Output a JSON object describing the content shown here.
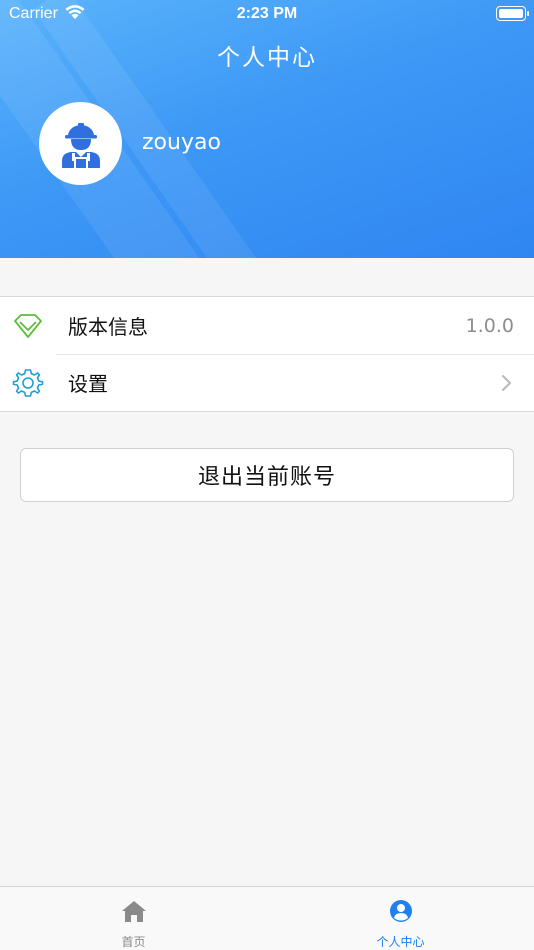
{
  "status_bar": {
    "carrier": "Carrier",
    "time": "2:23 PM"
  },
  "header": {
    "title": "个人中心",
    "username": "zouyao"
  },
  "list": {
    "items": [
      {
        "label": "版本信息",
        "value": "1.0.0",
        "icon": "diamond-icon"
      },
      {
        "label": "设置",
        "icon": "gear-icon"
      }
    ]
  },
  "logout": {
    "label": "退出当前账号"
  },
  "tab_bar": {
    "tabs": [
      {
        "label": "首页",
        "icon": "home-icon",
        "active": false
      },
      {
        "label": "个人中心",
        "icon": "user-circle-icon",
        "active": true
      }
    ]
  },
  "colors": {
    "header_gradient_start": "#5bb4fb",
    "header_gradient_end": "#2f86f1",
    "active_tab": "#1f7ff3",
    "diamond": "#5cbf3a",
    "gear": "#1d9fd6"
  }
}
